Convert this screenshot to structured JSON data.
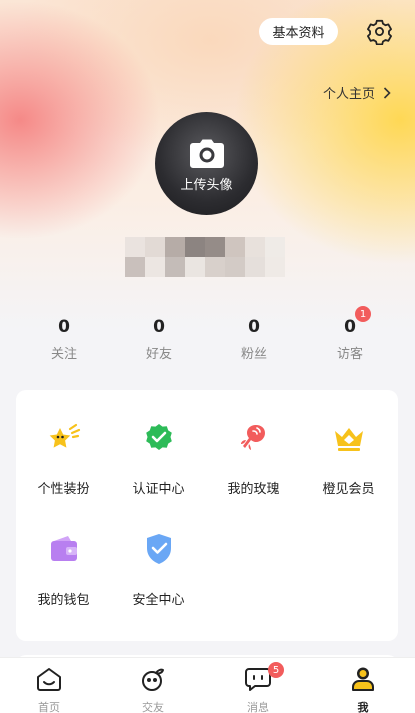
{
  "header": {
    "basic_info_button": "基本资料",
    "settings_icon": "gear-icon",
    "homepage_link": "个人主页"
  },
  "profile": {
    "upload_avatar_label": "上传头像",
    "camera_icon": "camera-icon"
  },
  "stats": [
    {
      "value": "0",
      "label": "关注"
    },
    {
      "value": "0",
      "label": "好友"
    },
    {
      "value": "0",
      "label": "粉丝"
    },
    {
      "value": "0",
      "label": "访客",
      "badge": "1"
    }
  ],
  "features": [
    {
      "label": "个性装扮",
      "icon": "sparkle-star-icon"
    },
    {
      "label": "认证中心",
      "icon": "verified-badge-icon"
    },
    {
      "label": "我的玫瑰",
      "icon": "rose-icon"
    },
    {
      "label": "橙见会员",
      "icon": "crown-icon"
    },
    {
      "label": "我的钱包",
      "icon": "wallet-icon"
    },
    {
      "label": "安全中心",
      "icon": "shield-check-icon"
    }
  ],
  "tabbar": {
    "items": [
      {
        "label": "首页",
        "icon": "home-icon"
      },
      {
        "label": "交友",
        "icon": "peach-icon"
      },
      {
        "label": "消息",
        "icon": "chat-bubble-icon",
        "badge": "5"
      },
      {
        "label": "我",
        "icon": "person-icon",
        "active": true
      }
    ]
  },
  "colors": {
    "accent_yellow": "#f7c21b",
    "badge_red": "#f25c5c",
    "verified_green": "#2dbb58",
    "rose_red": "#f25c5c",
    "wallet_purple": "#b87ff0",
    "shield_blue": "#6aa7f5"
  }
}
